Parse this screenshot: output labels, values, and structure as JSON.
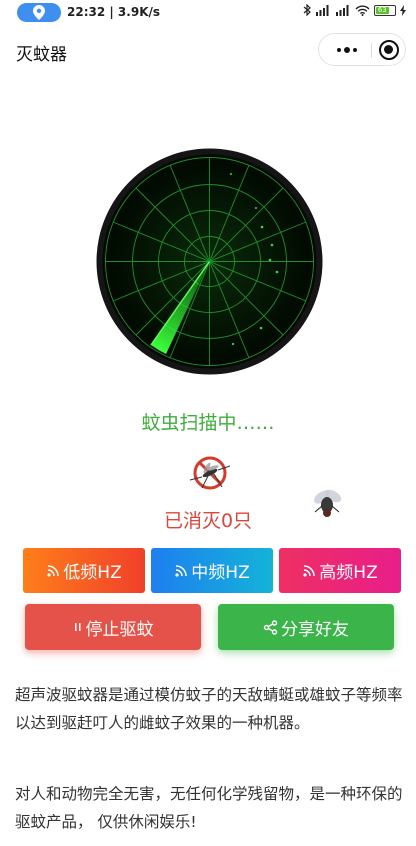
{
  "status_bar": {
    "time_speed": "22:32 | 3.9K/s",
    "battery": "63",
    "icons": [
      "location-icon",
      "bluetooth-icon",
      "signal-icon",
      "signal-icon",
      "wifi-icon",
      "battery-icon",
      "charging-icon"
    ]
  },
  "nav": {
    "title": "灭蚊器",
    "more_icon": "more-dots-icon",
    "close_icon": "mini-program-close-icon"
  },
  "radar": {
    "colors": {
      "bg": "#020c02",
      "grid": "#1f8f2a",
      "sweep": "#33ff33",
      "rim": "#111111"
    }
  },
  "scan_status": "蚊虫扫描中……",
  "kill_count_text": "已消灭0只",
  "buttons": {
    "low": "低频HZ",
    "mid": "中频HZ",
    "high": "高频HZ",
    "stop": "停止驱蚊",
    "share": "分享好友"
  },
  "description": {
    "p1": "超声波驱蚊器是通过模仿蚊子的天敌蜻蜓或雄蚊子等频率以达到驱赶叮人的雌蚊子效果的一种机器。",
    "p2": "对人和动物完全无害，无任何化学残留物，是一种环保的驱蚊产品， 仅供休闲娱乐!"
  }
}
